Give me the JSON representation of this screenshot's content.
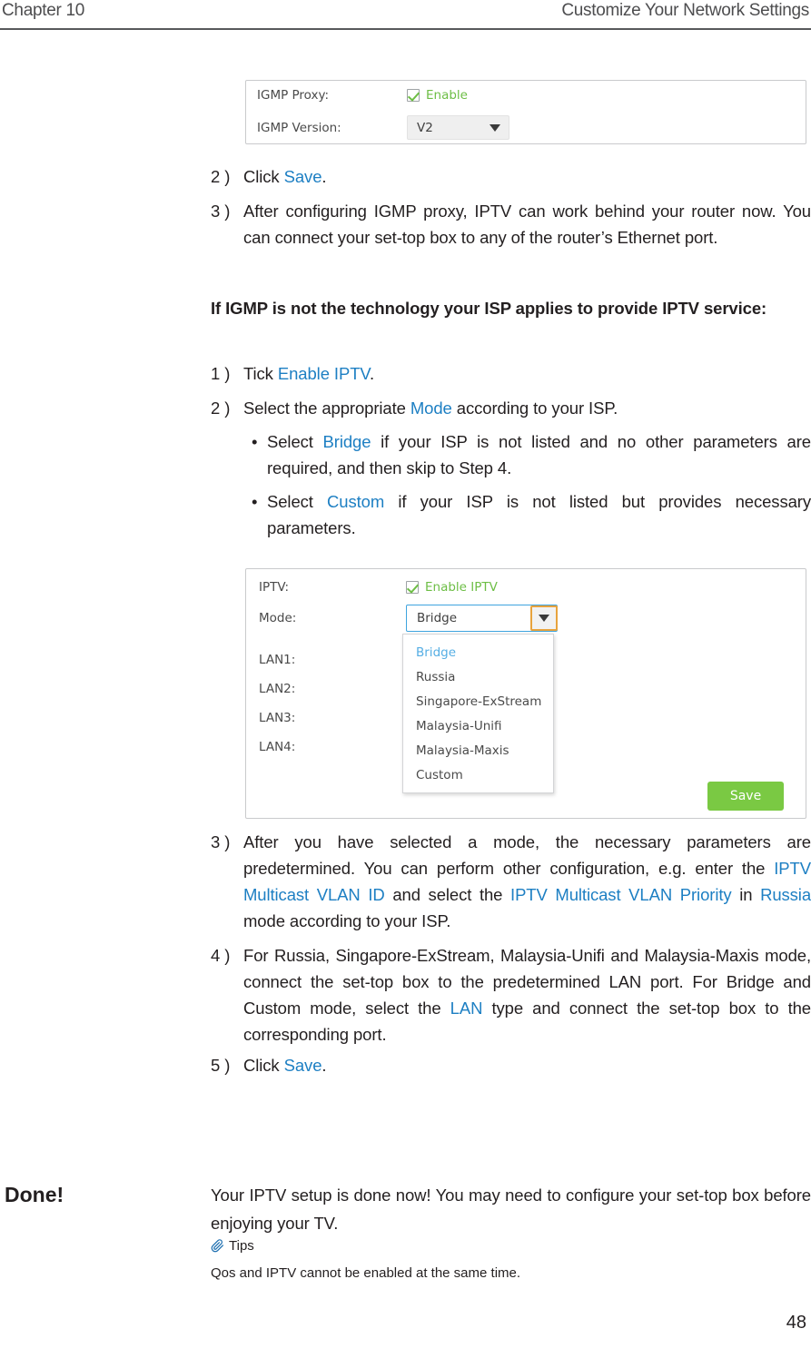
{
  "header": {
    "chapter": "Chapter 10",
    "section": "Customize Your Network Settings"
  },
  "igmp_panel": {
    "rows": [
      {
        "label": "IGMP Proxy:",
        "control": "checkbox",
        "checkbox_label": "Enable",
        "checked": true
      },
      {
        "label": "IGMP Version:",
        "control": "select",
        "value": "V2"
      }
    ]
  },
  "steps_top": [
    {
      "num": "2 )",
      "text_parts": [
        {
          "t": "Click ",
          "link": false
        },
        {
          "t": "Save",
          "link": true
        },
        {
          "t": ".",
          "link": false
        }
      ]
    },
    {
      "num": "3 )",
      "text_parts": [
        {
          "t": "After configuring IGMP proxy, IPTV can work behind your router now. You can connect your set-top box to any of the router’s Ethernet port.",
          "link": false
        }
      ]
    }
  ],
  "bold_note": "If IGMP is not the technology your ISP applies to provide IPTV service:",
  "steps_mid": [
    {
      "num": "1 )",
      "text_parts": [
        {
          "t": "Tick ",
          "link": false
        },
        {
          "t": "Enable IPTV",
          "link": true
        },
        {
          "t": ".",
          "link": false
        }
      ]
    },
    {
      "num": "2 )",
      "text_parts": [
        {
          "t": "Select the appropriate ",
          "link": false
        },
        {
          "t": "Mode",
          "link": true
        },
        {
          "t": " according to your ISP.",
          "link": false
        }
      ]
    }
  ],
  "bullets": [
    {
      "dot": "•",
      "parts": [
        {
          "t": "Select ",
          "link": false
        },
        {
          "t": "Bridge",
          "link": true
        },
        {
          "t": " if your ISP is not listed and no other parameters are required, and then skip to Step 4.",
          "link": false
        }
      ]
    },
    {
      "dot": "•",
      "parts": [
        {
          "t": "Select ",
          "link": false
        },
        {
          "t": "Custom",
          "link": true
        },
        {
          "t": " if your ISP is not listed but provides necessary parameters.",
          "link": false
        }
      ]
    }
  ],
  "iptv_panel": {
    "iptv_label": "IPTV:",
    "iptv_checkbox_label": "Enable IPTV",
    "iptv_checked": true,
    "mode_label": "Mode:",
    "mode_value": "Bridge",
    "mode_options": [
      "Bridge",
      "Russia",
      "Singapore-ExStream",
      "Malaysia-Unifi",
      "Malaysia-Maxis",
      "Custom"
    ],
    "selected_option_index": 0,
    "lan_labels": [
      "LAN1:",
      "LAN2:",
      "LAN3:",
      "LAN4:"
    ],
    "save_label": "Save"
  },
  "steps_bottom": [
    {
      "num": "3 )",
      "parts": [
        {
          "t": "After you have selected a mode, the necessary parameters are predetermined. You can perform other configuration, e.g. enter the ",
          "link": false
        },
        {
          "t": "IPTV Multicast VLAN ID",
          "link": true
        },
        {
          "t": " and select the ",
          "link": false
        },
        {
          "t": "IPTV Multicast VLAN Priority",
          "link": true
        },
        {
          "t": " in ",
          "link": false
        },
        {
          "t": "Russia",
          "link": true
        },
        {
          "t": " mode according to your ISP.",
          "link": false
        }
      ]
    },
    {
      "num": "4 )",
      "parts": [
        {
          "t": "For Russia, Singapore-ExStream, Malaysia-Unifi and Malaysia-Maxis mode, connect the set-top box to the predetermined LAN port. For Bridge and Custom mode, select the ",
          "link": false
        },
        {
          "t": "LAN",
          "link": true
        },
        {
          "t": " type and connect the set-top box to the corresponding port.",
          "link": false
        }
      ]
    },
    {
      "num": "5 )",
      "parts": [
        {
          "t": "Click ",
          "link": false
        },
        {
          "t": "Save",
          "link": true
        },
        {
          "t": ".",
          "link": false
        }
      ]
    }
  ],
  "done": {
    "label": "Done!",
    "text": "Your IPTV setup is done now! You may need to configure your set-top box before enjoying your TV.",
    "tips_icon": "paperclip-icon",
    "tips_label": "Tips",
    "tips_note": "Qos and IPTV cannot be enabled at the same time."
  },
  "page_number": "48",
  "colors": {
    "link": "#1d7fc3",
    "enable_green": "#6dbe45",
    "save_green": "#7ac943",
    "select_border_blue": "#3fa4de",
    "arrow_orange": "#e8a33d",
    "option_selected_blue": "#55aee4"
  }
}
